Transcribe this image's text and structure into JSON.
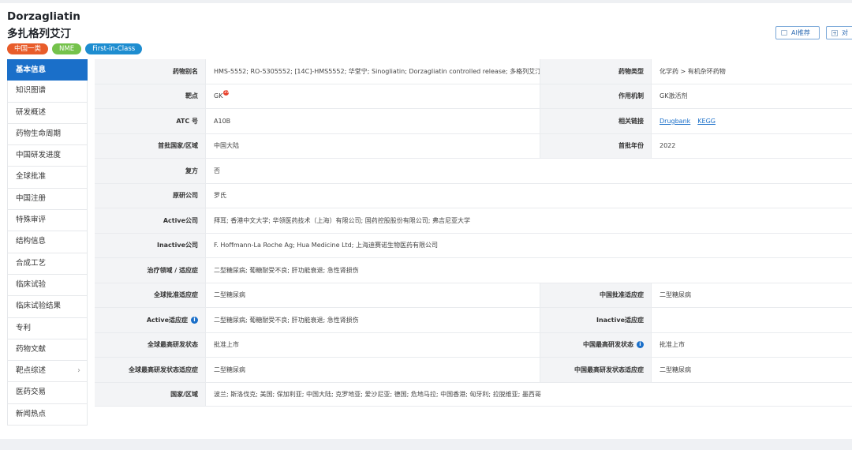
{
  "header": {
    "title_en": "Dorzagliatin",
    "title_cn": "多扎格列艾汀",
    "badges": [
      {
        "label": "中国一类",
        "color": "#e85c2a"
      },
      {
        "label": "NME",
        "color": "#74c24b"
      },
      {
        "label": "First-in-Class",
        "color": "#1e8dd0"
      }
    ],
    "buttons": {
      "ai_label": "AI推荐",
      "second_label": "对"
    }
  },
  "sidebar": {
    "items": [
      {
        "label": "基本信息",
        "active": true
      },
      {
        "label": "知识图谱"
      },
      {
        "label": "研发概述"
      },
      {
        "label": "药物生命周期"
      },
      {
        "label": "中国研发进度"
      },
      {
        "label": "全球批准"
      },
      {
        "label": "中国注册"
      },
      {
        "label": "特殊审评"
      },
      {
        "label": "结构信息"
      },
      {
        "label": "合成工艺"
      },
      {
        "label": "临床试验"
      },
      {
        "label": "临床试验结果"
      },
      {
        "label": "专利"
      },
      {
        "label": "药物文献"
      },
      {
        "label": "靶点综述",
        "has_chevron": true
      },
      {
        "label": "医药交易"
      },
      {
        "label": "新闻热点"
      }
    ]
  },
  "info": {
    "alias_label": "药物别名",
    "alias_value": "HMS-5552; RO-5305552; [14C]-HMS5552; 华堂宁; Sinogliatin; Dorzagliatin controlled release; 多格列艾汀",
    "drug_type_label": "药物类型",
    "drug_type_value": "化学药 > 有机杂环药物",
    "target_label": "靶点",
    "target_value": "GK",
    "target_badge": "19",
    "mechanism_label": "作用机制",
    "mechanism_value": "GK激活剂",
    "atc_label": "ATC 号",
    "atc_value": "A10B",
    "links_label": "相关链接",
    "link_drugbank": "Drugbank",
    "link_kegg": "KEGG",
    "first_region_label": "首批国家/区域",
    "first_region_value": "中国大陆",
    "first_year_label": "首批年份",
    "first_year_value": "2022",
    "compound_label": "复方",
    "compound_value": "否",
    "originator_label": "原研公司",
    "originator_value": "罗氏",
    "active_company_label": "Active公司",
    "active_company_value": "拜耳; 香港中文大学; 华领医药技术（上海）有限公司; 国药控股股份有限公司; 弗吉尼亚大学",
    "inactive_company_label": "Inactive公司",
    "inactive_company_value": "F. Hoffmann-La Roche Ag; Hua Medicine Ltd; 上海迪赛诺生物医药有限公司",
    "therapeutic_label": "治疗领域 / 适应症",
    "therapeutic_value": "二型糖尿病; 葡糖耐受不良; 肝功能衰退; 急性肾损伤",
    "global_approved_label": "全球批准适应症",
    "global_approved_value": "二型糖尿病",
    "china_approved_label": "中国批准适应症",
    "china_approved_value": "二型糖尿病",
    "active_indication_label": "Active适应症",
    "active_indication_value": "二型糖尿病; 葡糖耐受不良; 肝功能衰退; 急性肾损伤",
    "inactive_indication_label": "Inactive适应症",
    "inactive_indication_value": "",
    "global_highest_label": "全球最高研发状态",
    "global_highest_value": "批准上市",
    "china_highest_label": "中国最高研发状态",
    "china_highest_value": "批准上市",
    "global_highest_ind_label": "全球最高研发状态适应症",
    "global_highest_ind_value": "二型糖尿病",
    "china_highest_ind_label": "中国最高研发状态适应症",
    "china_highest_ind_value": "二型糖尿病",
    "country_label": "国家/区域",
    "country_value": "波兰; 斯洛伐克; 美国; 保加利亚; 中国大陆; 克罗地亚; 爱沙尼亚; 德国; 危地马拉; 中国香港; 匈牙利; 拉脱维亚; 墨西哥"
  },
  "icons": {
    "info": "info-icon",
    "chevron": "chevron-right-icon",
    "ai": "ai-icon",
    "add": "add-icon",
    "badge": "notification-badge-icon"
  }
}
